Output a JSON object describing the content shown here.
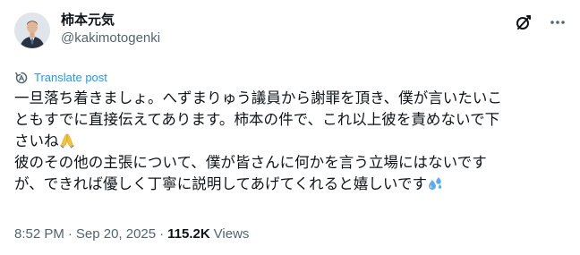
{
  "author": {
    "display_name": "柿本元気",
    "handle": "@kakimotogenki"
  },
  "icons": {
    "grok": "grok-icon",
    "more": "more-icon",
    "translate": "translate-icon",
    "pray_emoji": "folded-hands-emoji",
    "sweat_emoji": "sweat-droplets-emoji"
  },
  "translate_label": "Translate post",
  "post": {
    "lines": [
      "一旦落ち着きましょ。へずまりゅう議員から謝罪を頂き、僕が言いたいこ",
      "ともすでに直接伝えてあります。柿本の件で、これ以上彼を責めないで下",
      "さいね",
      "彼のその他の主張について、僕が皆さんに何かを言う立場にはないです",
      "が、できれば優しく丁寧に説明してあげてくれると嬉しいです"
    ]
  },
  "meta": {
    "time": "8:52 PM",
    "separator1": "·",
    "date": "Sep 20, 2025",
    "separator2": "·",
    "views_count": "115.2K",
    "views_label": "Views"
  },
  "colors": {
    "text": "#0f1419",
    "secondary": "#536471",
    "link": "#1d9bf0"
  }
}
